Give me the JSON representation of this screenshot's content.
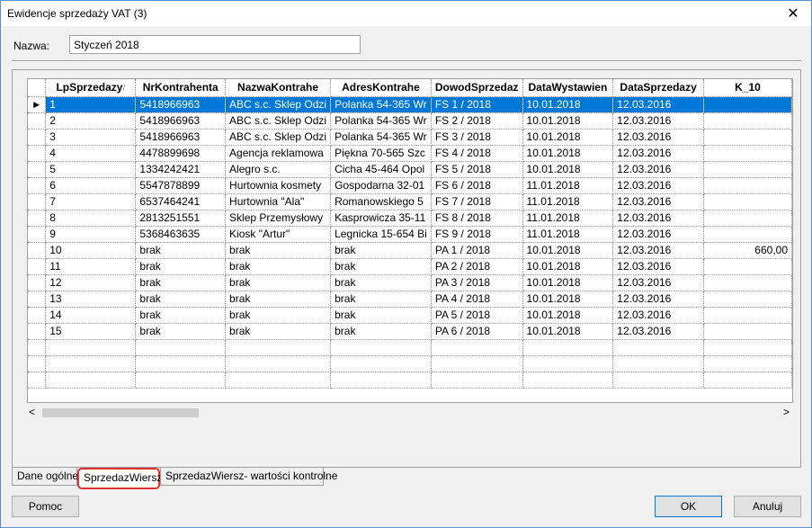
{
  "window": {
    "title": "Ewidencje sprzedaży VAT (3)",
    "close_glyph": "✕"
  },
  "form": {
    "name_label": "Nazwa:",
    "name_value": "Styczeń 2018"
  },
  "grid": {
    "columns": [
      "LpSprzedazy",
      "NrKontrahenta",
      "NazwaKontrahe",
      "AdresKontrahe",
      "DowodSprzedaz",
      "DataWystawien",
      "DataSprzedazy",
      "K_10"
    ],
    "sort_indicator": "/",
    "row_indicator": "▶",
    "rows": [
      [
        "1",
        "5418966963",
        "ABC s.c. Sklep Odzi",
        "Polanka  54-365 Wr",
        "FS 1 / 2018",
        "10.01.2018",
        "12.03.2016",
        ""
      ],
      [
        "2",
        "5418966963",
        "ABC s.c. Sklep Odzi",
        "Polanka  54-365 Wr",
        "FS 2 / 2018",
        "10.01.2018",
        "12.03.2016",
        ""
      ],
      [
        "3",
        "5418966963",
        "ABC s.c. Sklep Odzi",
        "Polanka  54-365 Wr",
        "FS 3 / 2018",
        "10.01.2018",
        "12.03.2016",
        ""
      ],
      [
        "4",
        "4478899698",
        "Agencja reklamowa",
        "Piękna  70-565 Szc",
        "FS 4 / 2018",
        "10.01.2018",
        "12.03.2016",
        ""
      ],
      [
        "5",
        "1334242421",
        "Alegro s.c.",
        "Cicha  45-464 Opol",
        "FS 5 / 2018",
        "10.01.2018",
        "12.03.2016",
        ""
      ],
      [
        "6",
        "5547878899",
        "Hurtownia kosmety",
        "Gospodarna  32-01",
        "FS 6 / 2018",
        "11.01.2018",
        "12.03.2016",
        ""
      ],
      [
        "7",
        "6537464241",
        "Hurtownia \"Ala\"",
        "Romanowskiego  5",
        "FS 7 / 2018",
        "11.01.2018",
        "12.03.2016",
        ""
      ],
      [
        "8",
        "2813251551",
        "Sklep Przemysłowy",
        "Kasprowicza  35-11",
        "FS 8 / 2018",
        "11.01.2018",
        "12.03.2016",
        ""
      ],
      [
        "9",
        "5368463635",
        "Kiosk \"Artur\"",
        "Legnicka  15-654 Bi",
        "FS 9 / 2018",
        "11.01.2018",
        "12.03.2016",
        ""
      ],
      [
        "10",
        "brak",
        "brak",
        "brak",
        "PA 1 / 2018",
        "10.01.2018",
        "12.03.2016",
        "660,00"
      ],
      [
        "11",
        "brak",
        "brak",
        "brak",
        "PA 2 / 2018",
        "10.01.2018",
        "12.03.2016",
        ""
      ],
      [
        "12",
        "brak",
        "brak",
        "brak",
        "PA 3 / 2018",
        "10.01.2018",
        "12.03.2016",
        ""
      ],
      [
        "13",
        "brak",
        "brak",
        "brak",
        "PA 4 / 2018",
        "10.01.2018",
        "12.03.2016",
        ""
      ],
      [
        "14",
        "brak",
        "brak",
        "brak",
        "PA 5 / 2018",
        "10.01.2018",
        "12.03.2016",
        ""
      ],
      [
        "15",
        "brak",
        "brak",
        "brak",
        "PA 6 / 2018",
        "10.01.2018",
        "12.03.2016",
        ""
      ]
    ],
    "selected_row": 0,
    "blank_rows": 3
  },
  "scrollbar": {
    "left_glyph": "<",
    "right_glyph": ">"
  },
  "tabs": [
    "Dane ogólne",
    "SprzedazWiersz",
    "SprzedazWiersz- wartości kontrolne"
  ],
  "buttons": {
    "help": "Pomoc",
    "ok": "OK",
    "cancel": "Anuluj"
  },
  "colors": {
    "selection": "#0078d7",
    "tab_highlight": "#e03030"
  }
}
